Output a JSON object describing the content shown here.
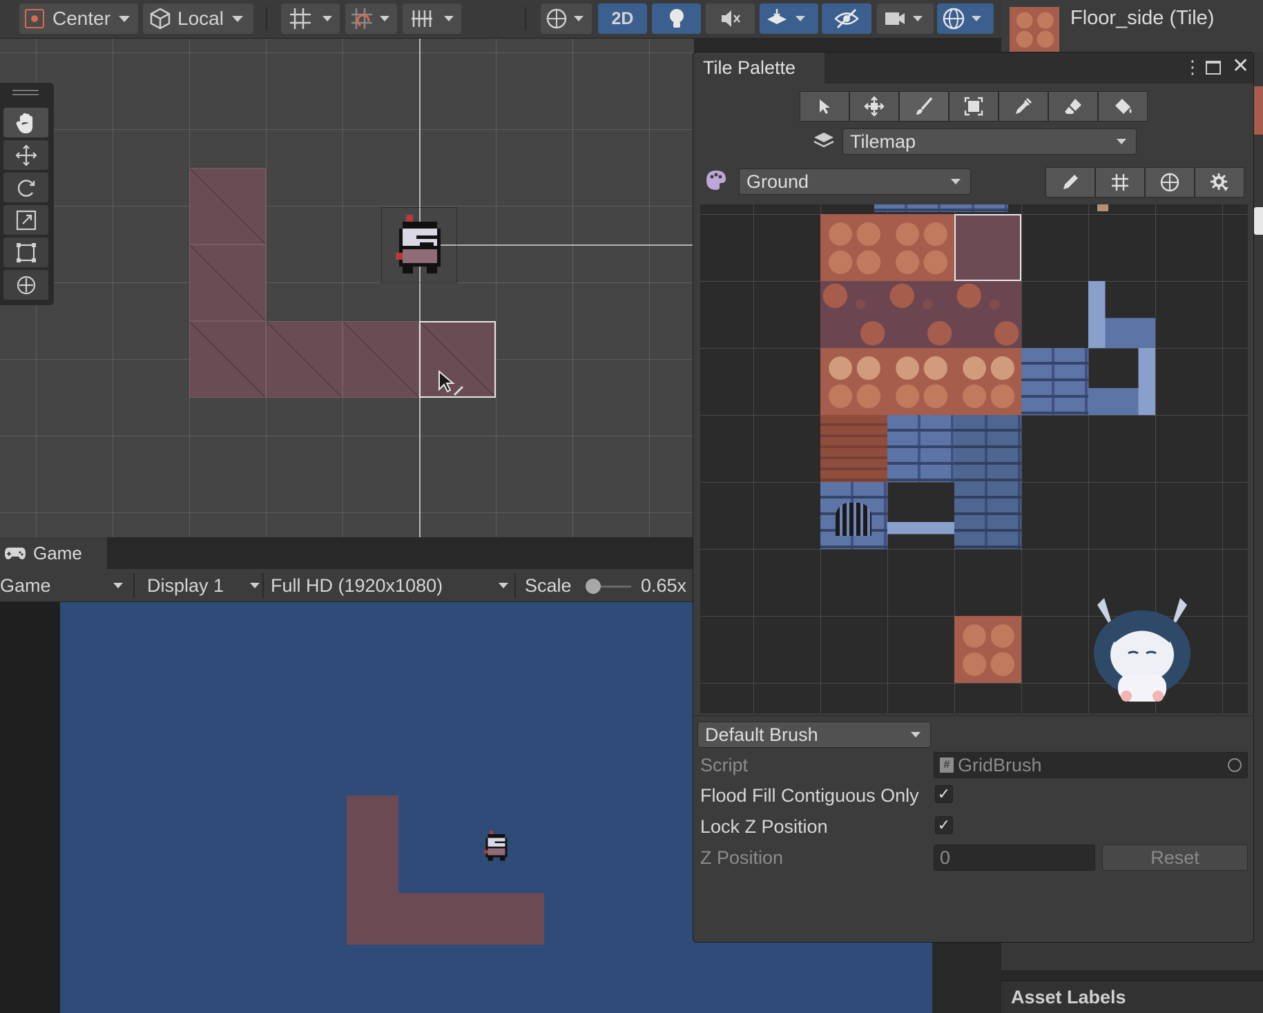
{
  "toolbar": {
    "pivot_label": "Center",
    "space_label": "Local",
    "mode_2d_label": "2D"
  },
  "inspector": {
    "asset_title": "Floor_side (Tile)",
    "asset_labels": "Asset Labels"
  },
  "tile_palette": {
    "tab_label": "Tile Palette",
    "target_label": "Tilemap",
    "palette_label": "Ground",
    "brush_label": "Default Brush",
    "script_label": "Script",
    "script_value": "GridBrush",
    "flood_fill_label": "Flood Fill Contiguous Only",
    "flood_fill_checked": true,
    "lock_z_label": "Lock Z Position",
    "lock_z_checked": true,
    "z_position_label": "Z Position",
    "z_position_value": "0",
    "reset_label": "Reset"
  },
  "game": {
    "tab_label": "Game",
    "view_select": "Game",
    "display_select": "Display 1",
    "resolution_select": "Full HD (1920x1080)",
    "scale_label": "Scale",
    "scale_value": "0.65x"
  },
  "colors": {
    "editor_bg": "#3c3c3c",
    "scene_bg": "#454545",
    "game_bg": "#2f4c79",
    "accent_blue": "#3b5f8f",
    "tile_floor": "#6a4c54"
  }
}
